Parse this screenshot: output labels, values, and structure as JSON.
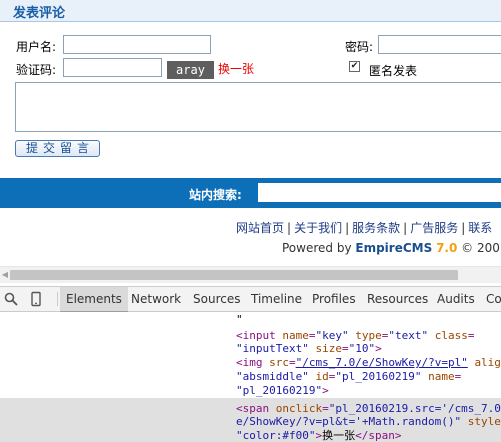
{
  "comment_form": {
    "title": "发表评论",
    "username_label": "用户名:",
    "password_label": "密码:",
    "captcha_label": "验证码:",
    "captcha_image_text": "aray",
    "refresh_label": "换一张",
    "anonymous_label": "匿名发表",
    "anonymous_checked": true,
    "submit_label": "提交留言"
  },
  "search": {
    "label": "站内搜索:"
  },
  "footer": {
    "links": [
      "网站首页",
      "关于我们",
      "服务条款",
      "广告服务",
      "联系"
    ],
    "powered_prefix": "Powered by ",
    "brand": "EmpireCMS",
    "version": "7.0",
    "copyright": "© 200"
  },
  "devtools": {
    "tabs": [
      "Elements",
      "Network",
      "Sources",
      "Timeline",
      "Profiles",
      "Resources",
      "Audits",
      "Co"
    ],
    "active_tab": "Elements",
    "code": {
      "l0": "\"",
      "l1_tag_open": "<input ",
      "l1_a1": "name",
      "l1_v1": "\"key\"",
      "l1_a2": "type",
      "l1_v2": "\"text\"",
      "l1_a3": "class",
      "l2_v3": "\"inputText\"",
      "l2_a4": "size",
      "l2_v4": "\"10\"",
      "l2_end": ">",
      "l3_tag_open": "<img ",
      "l3_a1": "src",
      "l3_v1": "\"/cms_7.0/e/ShowKey/?v=pl\"",
      "l3_a2": "alig",
      "l4_v2": "\"absmiddle\"",
      "l4_a3": "id",
      "l4_v3": "\"pl_20160219\"",
      "l4_a4": "name",
      "l5_v4": "\"pl_20160219\"",
      "l5_end": ">",
      "l6_tag_open": "<span ",
      "l6_a1": "onclick",
      "l6_v1": "\"pl_20160219.src='/cms_7.0",
      "l7_v1": "e/ShowKey/?v=pl&t='+Math.random()\"",
      "l7_a2": "style",
      "l8_v2": "\"color:#f00\"",
      "l8_text": "换一张",
      "l8_close": "</span>"
    }
  }
}
